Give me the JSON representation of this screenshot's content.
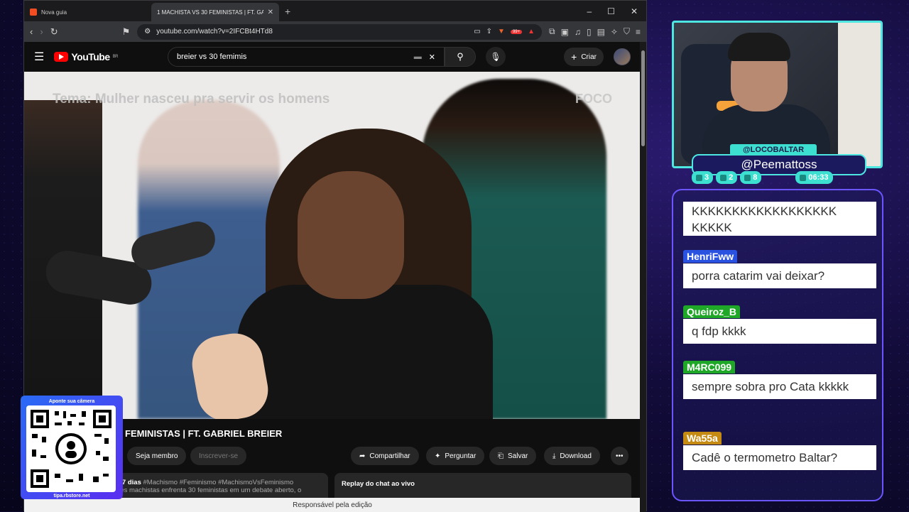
{
  "browser": {
    "tabs": [
      {
        "label": "Nova guia",
        "active": false
      },
      {
        "label": "1 MACHISTA VS 30 FEMINISTAS | FT. GA",
        "active": true
      }
    ],
    "url": "youtube.com/watch?v=2IFCBt4HTd8",
    "ext_badge": "99+"
  },
  "youtube": {
    "logo": "YouTube",
    "region": "BR",
    "search_query": "breier vs 30 femimis",
    "create_label": "Criar",
    "video_overlay_text": "Tema: Mulher nasceu pra servir os homens",
    "video_watermark": "FOCO",
    "title": "FEMINISTAS | FT. GABRIEL BREIER",
    "buttons": {
      "member": "Seja membro",
      "subscribe": "Inscrever-se",
      "share": "Compartilhar",
      "ask": "Perguntar",
      "save": "Salvar",
      "download": "Download"
    },
    "desc_meta": "á 7 dias",
    "desc_tags": "#Machismo #Feminismo #MachismoVsFeminismo",
    "desc_line": "ões machistas enfrenta 30 feministas em um debate aberto, o",
    "replay_label": "Replay do chat ao vivo",
    "footer": "Responsável pela edição"
  },
  "qr": {
    "top": "Aponte sua câmera",
    "bottom": "tipa.rbstore.net"
  },
  "overlay": {
    "handle_primary": "@LOCOBALTAR",
    "handle_secondary": "@Peemattoss",
    "stats": [
      {
        "icon": "chat-icon",
        "value": "3"
      },
      {
        "icon": "youtube-icon",
        "value": "2"
      },
      {
        "icon": "link-icon",
        "value": "8"
      },
      {
        "icon": "clock-icon",
        "value": "06:33"
      }
    ],
    "accent": "#4de6e0"
  },
  "chat": {
    "messages": [
      {
        "user": "",
        "text": "KKKKKKKKKKKKKKKKKK KKKKK",
        "color": ""
      },
      {
        "user": "HenriFww",
        "text": "porra catarim vai deixar?",
        "color": "#2a52e0"
      },
      {
        "user": "Queiroz_B",
        "text": "q fdp kkkk",
        "color": "#1fa828"
      },
      {
        "user": "M4RC099",
        "text": "sempre sobra pro Cata kkkkk",
        "color": "#1fa828"
      },
      {
        "user": "Wa55a",
        "text": "Cadê o termometro Baltar?",
        "color": "#c58a12"
      }
    ]
  }
}
